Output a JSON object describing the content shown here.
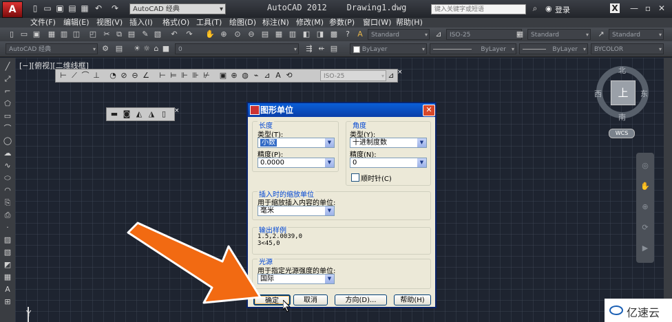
{
  "titlebar": {
    "app_logo": "A",
    "workspace": "AutoCAD 经典",
    "title": "AutoCAD 2012    Drawing1.dwg",
    "search_placeholder": "键入关键字或短语",
    "login": "登录",
    "win_min": "—",
    "win_max": "▫",
    "win_close": "✕"
  },
  "menu": {
    "items": [
      "文件(F)",
      "编辑(E)",
      "视图(V)",
      "插入(I)",
      "格式(O)",
      "工具(T)",
      "绘图(D)",
      "标注(N)",
      "修改(M)",
      "参数(P)",
      "窗口(W)",
      "帮助(H)"
    ]
  },
  "toolbar2": {
    "text_style": "Standard",
    "dim_style": "ISO-25",
    "table_style": "Standard",
    "mleader_style": "Standard"
  },
  "toolbar3": {
    "workspace": "AutoCAD 经典",
    "layer": "0",
    "color": "ByLayer",
    "linetype": "ByLayer",
    "lineweight": "ByLayer",
    "plotstyle": "BYCOLOR"
  },
  "viewport": {
    "label": "[−][俯视][二维线框]"
  },
  "dim_toolbar": {
    "style": "ISO-25"
  },
  "viewcube": {
    "north": "北",
    "south": "南",
    "east": "东",
    "west": "西",
    "face": "上",
    "wcs": "WCS"
  },
  "ucs": {
    "y_label": "Y"
  },
  "dialog": {
    "title": "图形单位",
    "length": {
      "group": "长度",
      "type_label": "类型(T):",
      "type_value": "小数",
      "precision_label": "精度(P):",
      "precision_value": "0.0000"
    },
    "angle": {
      "group": "角度",
      "type_label": "类型(Y):",
      "type_value": "十进制度数",
      "precision_label": "精度(N):",
      "precision_value": "0",
      "clockwise_label": "顺时针(C)",
      "clockwise_checked": false
    },
    "insert_scale": {
      "group": "插入时的缩放单位",
      "label": "用于缩放插入内容的单位:",
      "value": "毫米"
    },
    "sample": {
      "group": "输出样例",
      "line1": "1.5,2.0039,0",
      "line2": "3<45,0"
    },
    "lighting": {
      "group": "光源",
      "label": "用于指定光源强度的单位:",
      "value": "国际"
    },
    "buttons": {
      "ok": "确定",
      "cancel": "取消",
      "direction": "方向(D)...",
      "help": "帮助(H)"
    }
  },
  "watermark": {
    "text": "亿速云"
  },
  "colors": {
    "arrow": "#f26a12",
    "canvas_bg": "#1e2430",
    "dialog_title": "#0a4fd0"
  }
}
